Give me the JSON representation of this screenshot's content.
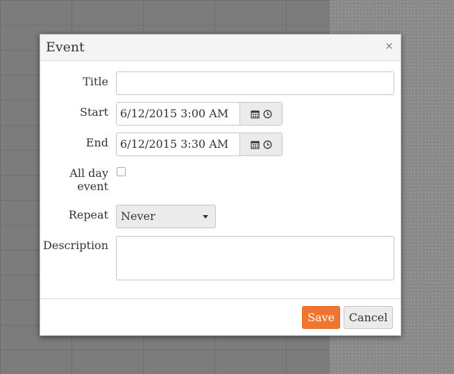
{
  "dialog": {
    "title": "Event",
    "close_symbol": "×"
  },
  "form": {
    "title_label": "Title",
    "title_value": "",
    "start_label": "Start",
    "start_value": "6/12/2015 3:00 AM",
    "end_label": "End",
    "end_value": "6/12/2015 3:30 AM",
    "allday_label_line1": "All day",
    "allday_label_line2": "event",
    "allday_checked": false,
    "repeat_label": "Repeat",
    "repeat_value": "Never",
    "description_label": "Description",
    "description_value": ""
  },
  "buttons": {
    "save": "Save",
    "cancel": "Cancel"
  },
  "icons": [
    "calendar-icon",
    "clock-icon",
    "close-icon",
    "dropdown-arrow-icon",
    "resize-handle-icon"
  ],
  "colors": {
    "save_button": "#ef7630",
    "backdrop": "#7c7c7c"
  }
}
